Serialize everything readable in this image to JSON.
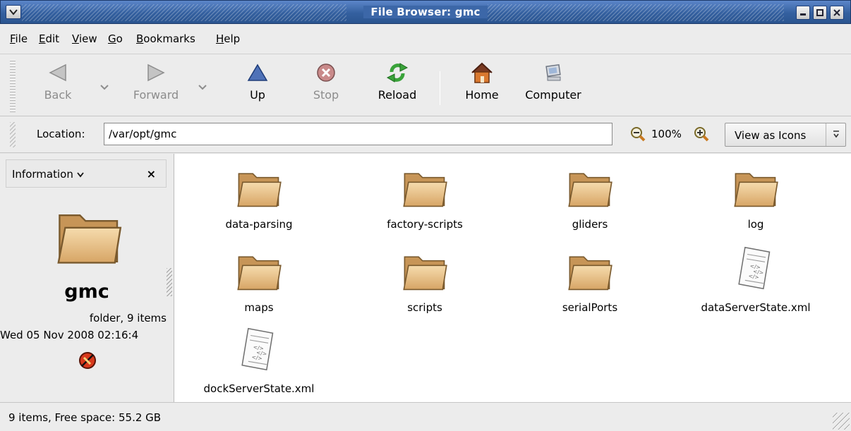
{
  "window": {
    "title": "File Browser: gmc",
    "menu_icon": "chevron-down-icon",
    "controls": [
      "minimize-icon",
      "maximize-icon",
      "close-icon"
    ]
  },
  "menu": {
    "items": [
      {
        "key": "F",
        "rest": "ile"
      },
      {
        "key": "E",
        "rest": "dit"
      },
      {
        "key": "V",
        "rest": "iew"
      },
      {
        "key": "G",
        "rest": "o"
      },
      {
        "key": "B",
        "rest": "ookmarks"
      },
      {
        "key": "H",
        "rest": "elp"
      }
    ]
  },
  "toolbar": {
    "back_label": "Back",
    "forward_label": "Forward",
    "up_label": "Up",
    "stop_label": "Stop",
    "reload_label": "Reload",
    "home_label": "Home",
    "computer_label": "Computer"
  },
  "location": {
    "label": "Location:",
    "value": "/var/opt/gmc",
    "zoom": "100%",
    "view_mode": "View as Icons"
  },
  "side_pane": {
    "header": "Information",
    "close_glyph": "×",
    "folder_name": "gmc",
    "folder_info": "folder, 9 items",
    "modified": "Wed 05 Nov 2008 02:16:4"
  },
  "files": [
    {
      "name": "data-parsing",
      "icon": "folder-icon"
    },
    {
      "name": "factory-scripts",
      "icon": "folder-icon"
    },
    {
      "name": "gliders",
      "icon": "folder-icon"
    },
    {
      "name": "log",
      "icon": "folder-icon"
    },
    {
      "name": "maps",
      "icon": "folder-icon"
    },
    {
      "name": "scripts",
      "icon": "folder-icon"
    },
    {
      "name": "serialPorts",
      "icon": "folder-icon"
    },
    {
      "name": "dataServerState.xml",
      "icon": "xml-file-icon"
    },
    {
      "name": "dockServerState.xml",
      "icon": "xml-file-icon"
    }
  ],
  "status": {
    "text": "9 items, Free space: 55.2 GB"
  },
  "colors": {
    "titlebar": "#34609f",
    "folder": "#e9c187"
  }
}
